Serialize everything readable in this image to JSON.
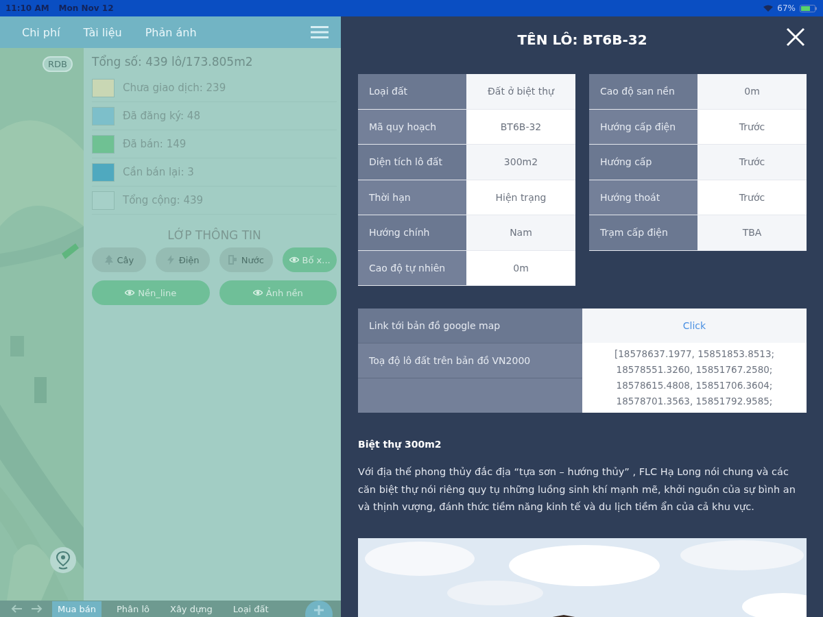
{
  "status_bar": {
    "time": "11:10 AM",
    "date": "Mon Nov 12",
    "battery_text": "67%"
  },
  "top_tabs": [
    {
      "label": "Chi phí"
    },
    {
      "label": "Tài liệu"
    },
    {
      "label": "Phản ánh"
    }
  ],
  "map": {
    "badge": "RDB"
  },
  "summary": {
    "total": "Tổng số: 439 lô/173.805m2",
    "legend": [
      {
        "label": "Chưa giao dịch: 239",
        "color": "#c9d7b4"
      },
      {
        "label": "Đã đăng ký: 48",
        "color": "#7dbfca"
      },
      {
        "label": "Đã bán: 149",
        "color": "#6fc193"
      },
      {
        "label": "Cần bán lại: 3",
        "color": "#4fa9bf"
      },
      {
        "label": "Tổng cộng: 439",
        "color": "#a6d0c8"
      }
    ]
  },
  "layers": {
    "title": "LỚP THÔNG TIN",
    "buttons": [
      {
        "label": "Cây",
        "kind": "tree",
        "on": false
      },
      {
        "label": "Điện",
        "kind": "power",
        "on": false
      },
      {
        "label": "Nước",
        "kind": "water",
        "on": false
      },
      {
        "label": "Bố x...",
        "kind": "eye",
        "on": true
      }
    ],
    "wide_buttons": [
      {
        "label": "Nền_line",
        "kind": "eye",
        "on": true
      },
      {
        "label": "Ảnh nền",
        "kind": "eye",
        "on": true
      }
    ]
  },
  "bottom_tabs": [
    {
      "label": "Mua bán",
      "selected": true
    },
    {
      "label": "Phân lô",
      "selected": false
    },
    {
      "label": "Xây dựng",
      "selected": false
    },
    {
      "label": "Loại đất",
      "selected": false
    }
  ],
  "detail": {
    "title": "TÊN LÔ: BT6B-32",
    "left_table": [
      {
        "label": "Loại đất",
        "value": "Đất ở biệt thự"
      },
      {
        "label": "Mã quy hoạch",
        "value": "BT6B-32"
      },
      {
        "label": "Diện tích lô đất",
        "value": "300m2"
      },
      {
        "label": "Thời hạn",
        "value": "Hiện trạng"
      },
      {
        "label": "Hướng chính",
        "value": "Nam"
      },
      {
        "label": "Cao độ tự nhiên",
        "value": "0m"
      }
    ],
    "right_table": [
      {
        "label": "Cao độ san nền",
        "value": "0m"
      },
      {
        "label": "Hướng cấp điện",
        "value": "Trước"
      },
      {
        "label": "Hướng cấp",
        "value": "Trước"
      },
      {
        "label": "Hướng thoát",
        "value": "Trước"
      },
      {
        "label": "Trạm cấp điện",
        "value": "TBA"
      }
    ],
    "map_link": {
      "label": "Link tới bản đồ google map",
      "link": "Click"
    },
    "coordinates": {
      "label": "Toạ độ lô đất trên bản đồ VN2000",
      "lines": [
        "[18578637.1977, 15851853.8513;",
        "18578551.3260, 15851767.2580;",
        "18578615.4808, 15851706.3604;",
        "18578701.3563, 15851792.9585;"
      ]
    },
    "heading": "Biệt thự 300m2",
    "description": "Với địa thế phong thủy đắc địa “tựa sơn – hướng thủy” , FLC Hạ Long nói chung và các căn biệt thự nói riêng quy tụ những luồng sinh khí mạnh mẽ, khởi nguồn của sự bình an và thịnh vượng, đánh thức tiềm năng kinh tế và du lịch tiềm ẩn của cả khu vực."
  }
}
